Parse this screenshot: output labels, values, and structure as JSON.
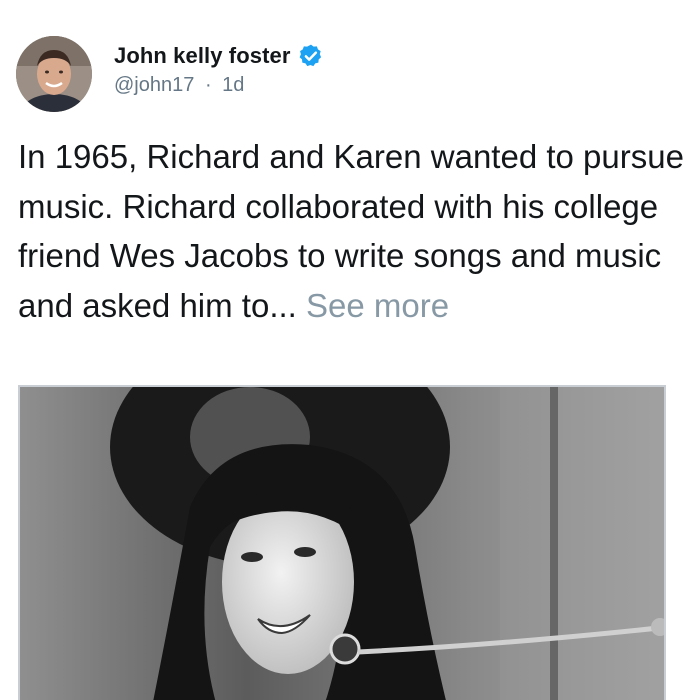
{
  "tweet": {
    "author": {
      "display_name": "John kelly foster",
      "handle": "@john17",
      "separator": "·",
      "time": "1d",
      "verified": true,
      "verified_icon": "verified-badge-icon",
      "verified_color": "#1da1f2"
    },
    "text": "In 1965, Richard and Karen wanted to pursue music. Richard collaborated with his college friend Wes Jacobs to write songs and music and asked him to...",
    "see_more_label": "See more",
    "media": {
      "type": "photo",
      "style": "black-and-white"
    }
  },
  "colors": {
    "text_primary": "#14171a",
    "text_secondary": "#657786",
    "link_muted": "#8899a6"
  }
}
